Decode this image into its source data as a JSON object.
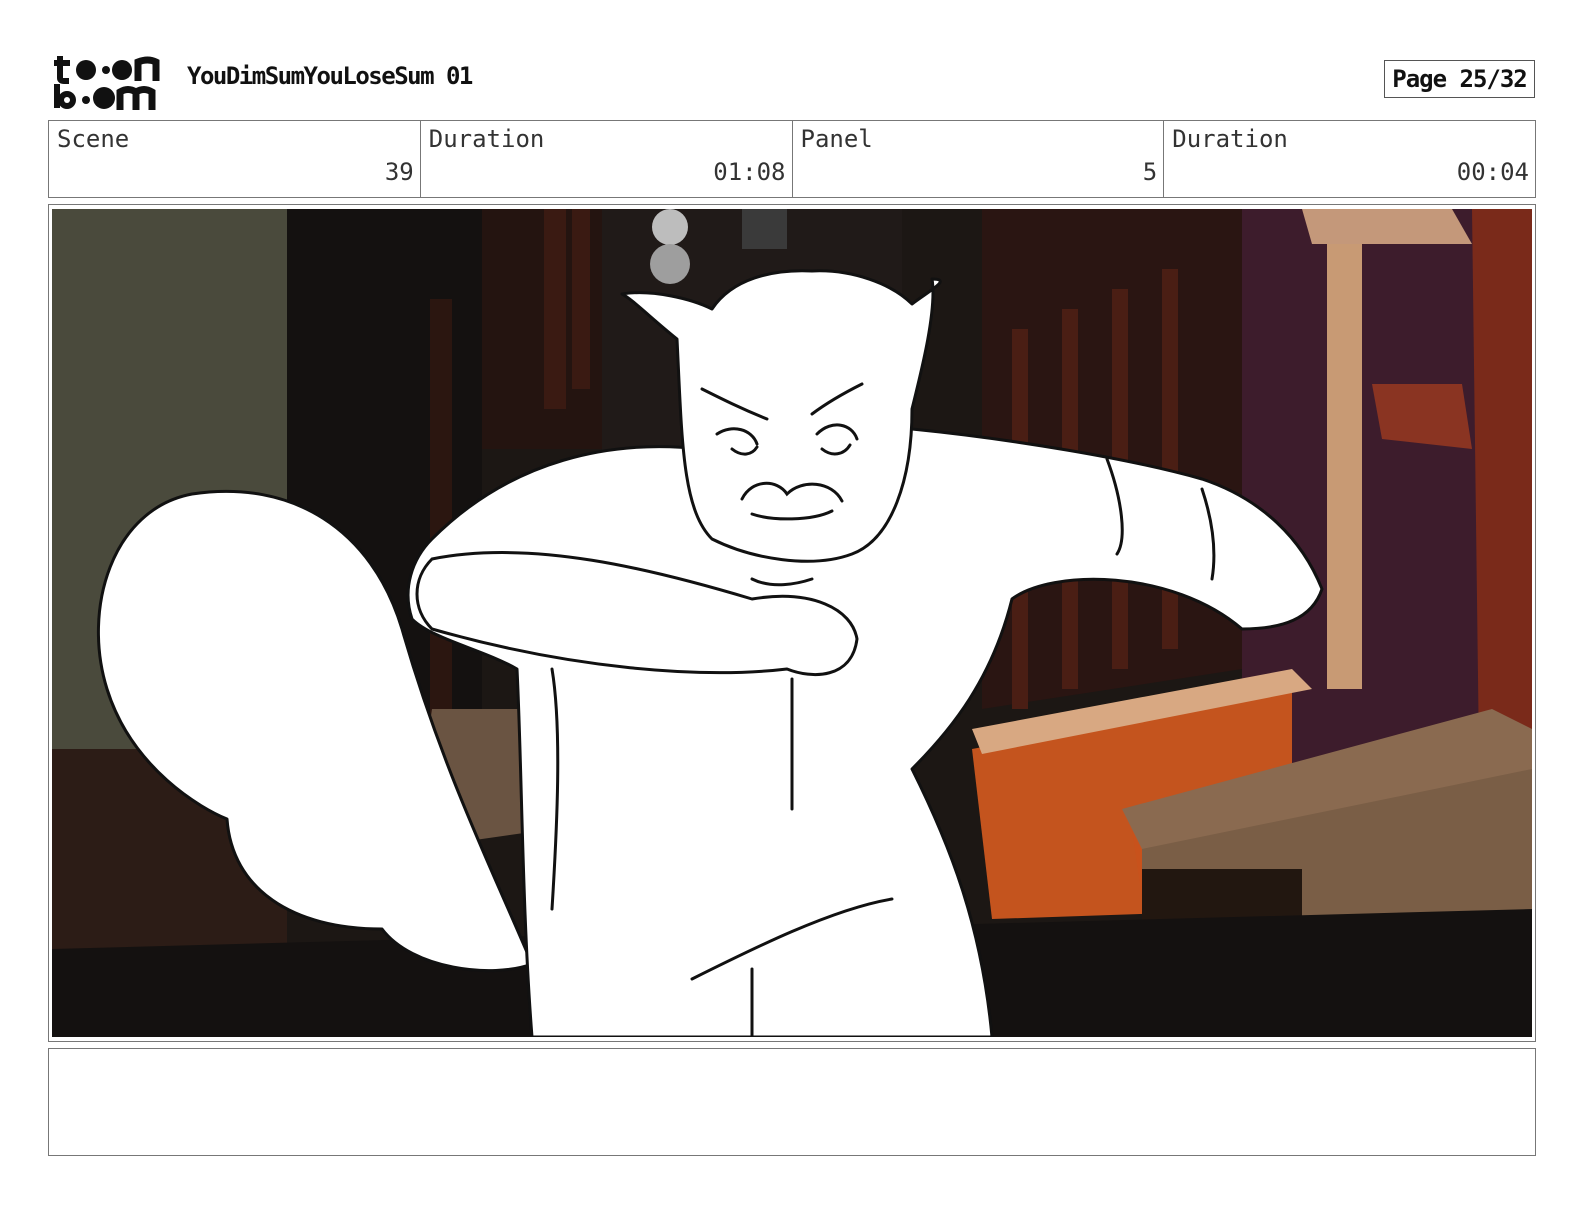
{
  "header": {
    "logo_text": "toon boom",
    "project_title": "YouDimSumYouLoseSum 01",
    "page_label": "Page 25/32"
  },
  "info": {
    "scene_label": "Scene",
    "scene_value": "39",
    "scene_duration_label": "Duration",
    "scene_duration_value": "01:08",
    "panel_label": "Panel",
    "panel_value": "5",
    "panel_duration_label": "Duration",
    "panel_duration_value": "00:04"
  },
  "notes": {
    "text": ""
  }
}
